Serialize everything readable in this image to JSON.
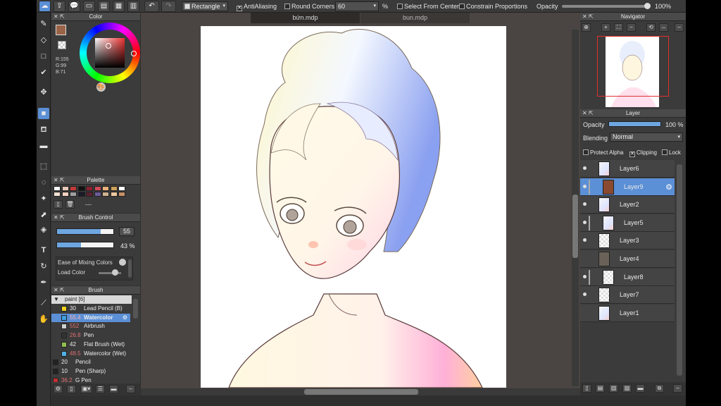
{
  "toolbar": {
    "shape": "Rectangle",
    "anti_aliasing": "AntiAliasing",
    "round_corners": "Round Corners",
    "round_value": "60",
    "percent": "%",
    "select_from_center": "Select From Center",
    "constrain": "Constrain Proportions",
    "opacity_label": "Opacity",
    "opacity_value": "100%",
    "opacity_fraction": 0.98
  },
  "tabs": [
    "bứn.mdp",
    "bun.mdp"
  ],
  "color_panel": {
    "title": "Color",
    "r": "R:155",
    "g": "G:99",
    "b": "B:71",
    "primary": "#9b6347"
  },
  "palette_panel": {
    "title": "Palette",
    "dashes": "---",
    "swatches": [
      "#f7f7f7",
      "#e6c8b8",
      "#c23a3a",
      "#111111",
      "#8c2030",
      "#d04a5a",
      "#e8b07a",
      "#caa05a",
      "#ffffff",
      "#f0e0d0",
      "#f2d2c2",
      "#a0a0a0",
      "#1a1a2a",
      "#5a2030",
      "#6a5a9a",
      "#d0b090",
      "#f0c8a0",
      "#c89068"
    ]
  },
  "brush_control": {
    "title": "Brush Control",
    "size_value": "55",
    "opacity_value": "43 %",
    "size_fraction": 0.78,
    "opacity_fraction": 0.43,
    "ease_label": "Ease of Mixing Colors",
    "load_label": "Load Color"
  },
  "brush_panel": {
    "title": "Brush",
    "group": "paint [6]",
    "items": [
      {
        "size": "30",
        "name": "Lead Pencil (B)",
        "color": "#f0d020",
        "sel": false,
        "red": false,
        "kind": "sub"
      },
      {
        "size": "55.4",
        "name": "Watercolor",
        "color": "#40a0e0",
        "sel": true,
        "red": true,
        "kind": "sub"
      },
      {
        "size": "552",
        "name": "Airbrush",
        "color": "#d0d0d0",
        "sel": false,
        "red": true,
        "kind": "sub"
      },
      {
        "size": "26.8",
        "name": "Pen",
        "color": "#333333",
        "sel": false,
        "red": true,
        "kind": "sub"
      },
      {
        "size": "42",
        "name": "Flat Brush (Wet)",
        "color": "#90c050",
        "sel": false,
        "red": false,
        "kind": "sub"
      },
      {
        "size": "48.5",
        "name": "Watercolor (Wet)",
        "color": "#50b0e0",
        "sel": false,
        "red": true,
        "kind": "sub"
      },
      {
        "size": "20",
        "name": "Pencil",
        "color": "#222222",
        "sel": false,
        "red": false,
        "kind": "top"
      },
      {
        "size": "10",
        "name": "Pen (Sharp)",
        "color": "#222222",
        "sel": false,
        "red": false,
        "kind": "top"
      },
      {
        "size": "36.2",
        "name": "G Pen",
        "color": "#c03030",
        "sel": false,
        "red": true,
        "kind": "top"
      }
    ]
  },
  "navigator": {
    "title": "Navigator"
  },
  "layer_panel": {
    "title": "Layer",
    "opacity_label": "Opacity",
    "opacity_value": "100 %",
    "blending_label": "Blending",
    "blending_value": "Normal",
    "protect_alpha": "Protect Alpha",
    "clipping": "Clipping",
    "lock": "Lock",
    "layers": [
      {
        "name": "Layer6",
        "visible": true,
        "clip": false,
        "sel": false,
        "thumb": "sketch"
      },
      {
        "name": "Layer9",
        "visible": true,
        "clip": true,
        "sel": true,
        "thumb": "brown"
      },
      {
        "name": "Layer2",
        "visible": true,
        "clip": false,
        "sel": false,
        "thumb": "sketch"
      },
      {
        "name": "Layer5",
        "visible": true,
        "clip": true,
        "sel": false,
        "thumb": "sketch"
      },
      {
        "name": "Layer3",
        "visible": true,
        "clip": false,
        "sel": false,
        "thumb": "check"
      },
      {
        "name": "Layer4",
        "visible": false,
        "clip": false,
        "sel": false,
        "thumb": "gray"
      },
      {
        "name": "Layer8",
        "visible": true,
        "clip": true,
        "sel": false,
        "thumb": "check"
      },
      {
        "name": "Layer7",
        "visible": true,
        "clip": false,
        "sel": false,
        "thumb": "check"
      },
      {
        "name": "Layer1",
        "visible": false,
        "clip": false,
        "sel": false,
        "thumb": "sketch"
      }
    ]
  }
}
